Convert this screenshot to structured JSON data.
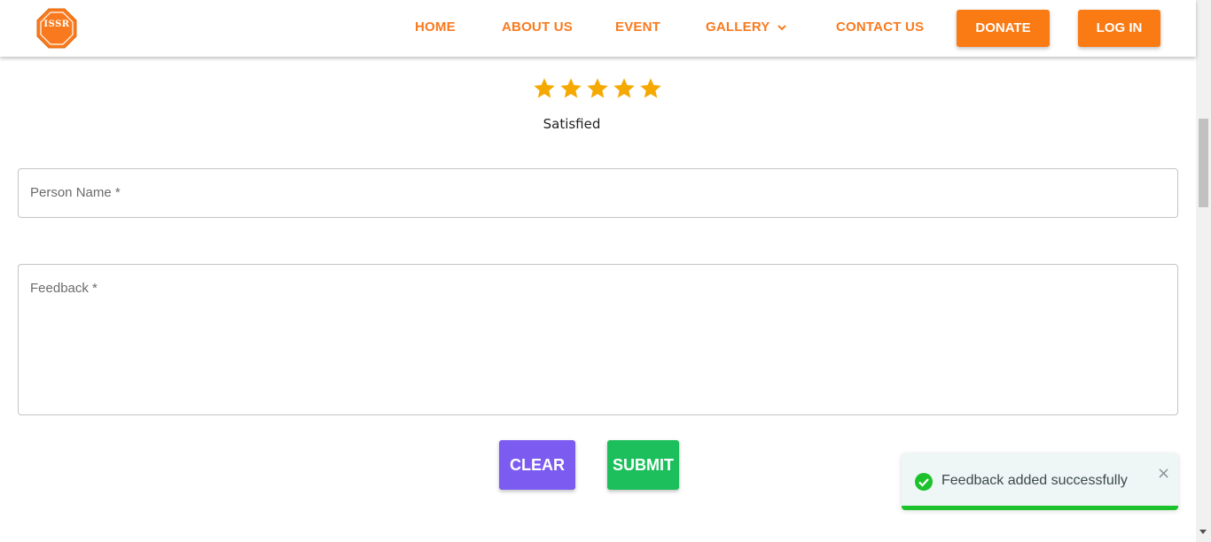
{
  "header": {
    "logo_text": "ISSR",
    "nav": {
      "home": "HOME",
      "about": "ABOUT US",
      "event": "EVENT",
      "gallery": "GALLERY",
      "contact": "CONTACT US"
    },
    "donate_label": "DONATE",
    "login_label": "LOG IN",
    "accent_color": "#f97a1e"
  },
  "rating": {
    "stars_filled": 5,
    "stars_total": 5,
    "label": "Satisfied",
    "star_color": "#f5a800"
  },
  "form": {
    "person_name_label": "Person Name *",
    "person_name_value": "",
    "feedback_label": "Feedback *",
    "feedback_value": "",
    "clear_label": "CLEAR",
    "submit_label": "SUBMIT"
  },
  "toast": {
    "message": "Feedback added successfully",
    "close_icon": "close-icon",
    "status_icon": "check-circle-icon",
    "progress": 1.0,
    "color": "#1cc22b"
  }
}
